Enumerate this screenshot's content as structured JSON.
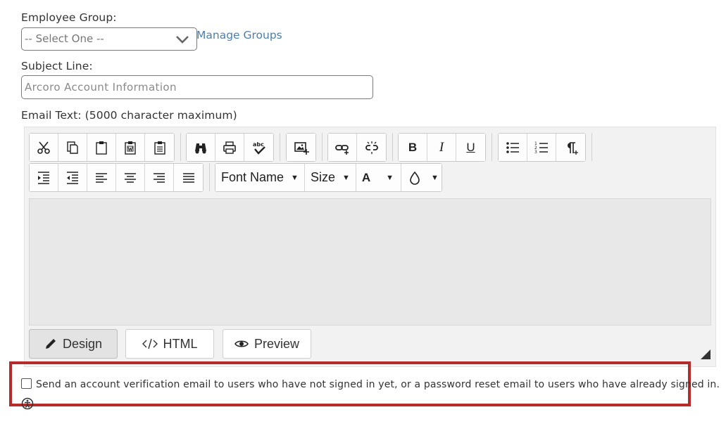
{
  "employee_group": {
    "label": "Employee Group:",
    "selected": "-- Select One --",
    "manage_link": "Manage Groups"
  },
  "subject": {
    "label": "Subject Line:",
    "placeholder": "Arcoro Account Information"
  },
  "email_text": {
    "label": "Email Text: (5000 character maximum)"
  },
  "toolbar": {
    "bold": "B",
    "italic": "I",
    "underline": "U",
    "font_name": "Font Name",
    "size": "Size",
    "font_color": "A"
  },
  "modes": {
    "design": "Design",
    "html": "HTML",
    "preview": "Preview"
  },
  "checkbox": {
    "label": "Send an account verification email to users who have not signed in yet, or a password reset email to users who have already signed in.",
    "checked": false
  },
  "colors": {
    "link": "#4a7fb0",
    "highlight_border": "#b52b2b"
  }
}
